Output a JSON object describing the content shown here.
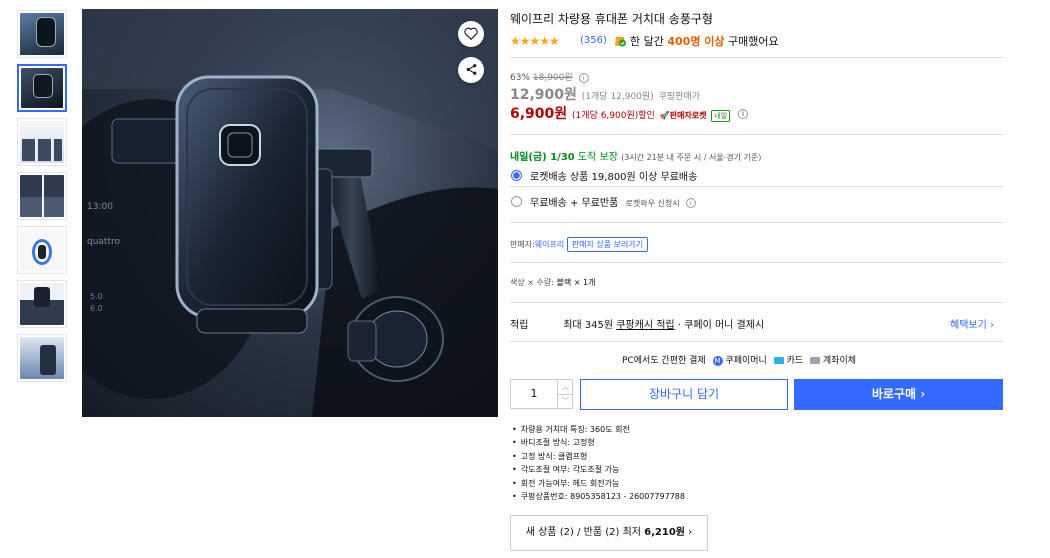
{
  "product": {
    "title": "웨이프리 차량용 휴대폰 거치대 송풍구형",
    "rating_stars": "★★★★★",
    "review_count": "(356)",
    "bought_prefix": "한 달간 ",
    "bought_count": "400명 이상",
    "bought_suffix": " 구매했어요"
  },
  "price": {
    "discount_rate": "63%",
    "original_price": "18,900원",
    "coupang_price": "12,900원",
    "coupang_unit": "(1개당 12,900원)",
    "coupang_label": "쿠팡판매가",
    "discount_price": "6,900원",
    "discount_unit": "(1개당 6,900원)",
    "discount_label": "할인",
    "rocket_label": "판매자로켓",
    "rocket_badge": "내일"
  },
  "delivery": {
    "arrival": "내일(금) 1/30",
    "arrival_suffix": " 도착 보장",
    "guide": "(3시간 21분 내 주문 시 / 서울⋅경기 기준)"
  },
  "shipping_options": [
    {
      "label": "로켓배송 상품 19,800원 이상 무료배송",
      "selected": true
    },
    {
      "label": "무료배송 + 무료반품",
      "sub": "로켓와우 신청시",
      "selected": false
    }
  ],
  "seller": {
    "label": "판매자:",
    "name": "웨이프리",
    "more_button": "판매자 상품 보러가기"
  },
  "option": {
    "text": "색상 × 수량: ",
    "value": "블랙 × 1개"
  },
  "earn": {
    "label": "적립",
    "max": "최대 345원",
    "cash": "쿠팡캐시 적립",
    "rest": "· 쿠페이 머니 결제시",
    "benefit_button": "혜택보기"
  },
  "payment": {
    "headline": "PC에서도 간편한 결제",
    "methods": [
      "쿠페이머니",
      "카드",
      "계좌이체"
    ]
  },
  "purchase": {
    "quantity": "1",
    "cart_button": "장바구니 담기",
    "buy_button": "바로구매"
  },
  "specs": [
    "차량용 거치대 특징: 360도 회전",
    "바디조절 방식: 고정형",
    "고정 방식: 클램프형",
    "각도조절 여부: 각도조절 가능",
    "회전 가능여부: 헤드 회전가능",
    "쿠팡상품번호: 8905358123 - 26007797788"
  ],
  "offers": {
    "text": "새 상품 (2) / 반품 (2) 최저 ",
    "price": "6,210원"
  },
  "colors": {
    "accent": "#346aff",
    "price_red": "#ae0000",
    "delivery_green": "#00891a",
    "star": "#f5a623",
    "bought_orange": "#e05d00"
  }
}
